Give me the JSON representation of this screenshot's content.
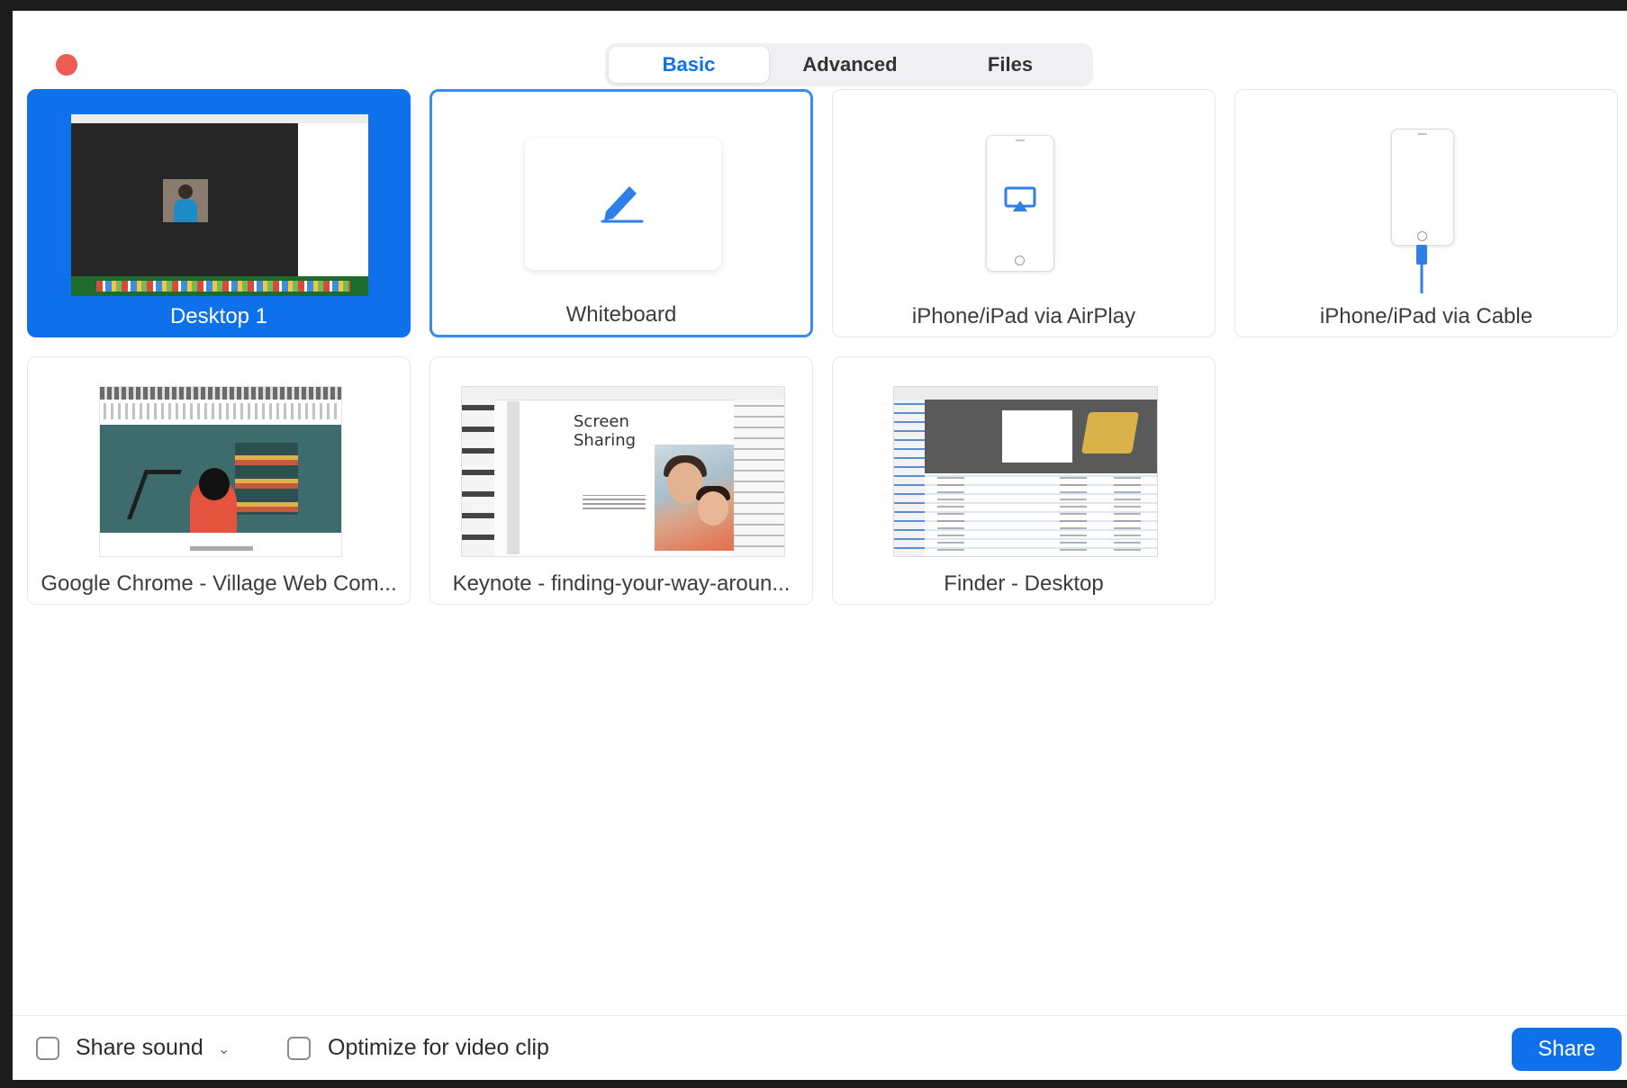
{
  "tabs": [
    {
      "label": "Basic",
      "active": true
    },
    {
      "label": "Advanced",
      "active": false
    },
    {
      "label": "Files",
      "active": false
    }
  ],
  "sources": [
    {
      "label": "Desktop 1",
      "icon": "desktop-thumbnail",
      "state": "selected"
    },
    {
      "label": "Whiteboard",
      "icon": "pencil-icon",
      "state": "focused"
    },
    {
      "label": "iPhone/iPad via AirPlay",
      "icon": "airplay-phone-icon",
      "state": "normal"
    },
    {
      "label": "iPhone/iPad via Cable",
      "icon": "cable-phone-icon",
      "state": "normal"
    },
    {
      "label": "Google Chrome - Village Web Com...",
      "icon": "chrome-window-thumbnail",
      "state": "normal"
    },
    {
      "label": "Keynote - finding-your-way-aroun...",
      "icon": "keynote-window-thumbnail",
      "state": "normal"
    },
    {
      "label": "Finder - Desktop",
      "icon": "finder-window-thumbnail",
      "state": "normal"
    }
  ],
  "keynote_slide_title": "Screen Sharing",
  "options": {
    "share_sound": {
      "label": "Share sound",
      "checked": false
    },
    "optimize_video": {
      "label": "Optimize for video clip",
      "checked": false
    }
  },
  "share_button": "Share",
  "colors": {
    "accent": "#0e71eb",
    "close_button": "#ee5b52"
  }
}
